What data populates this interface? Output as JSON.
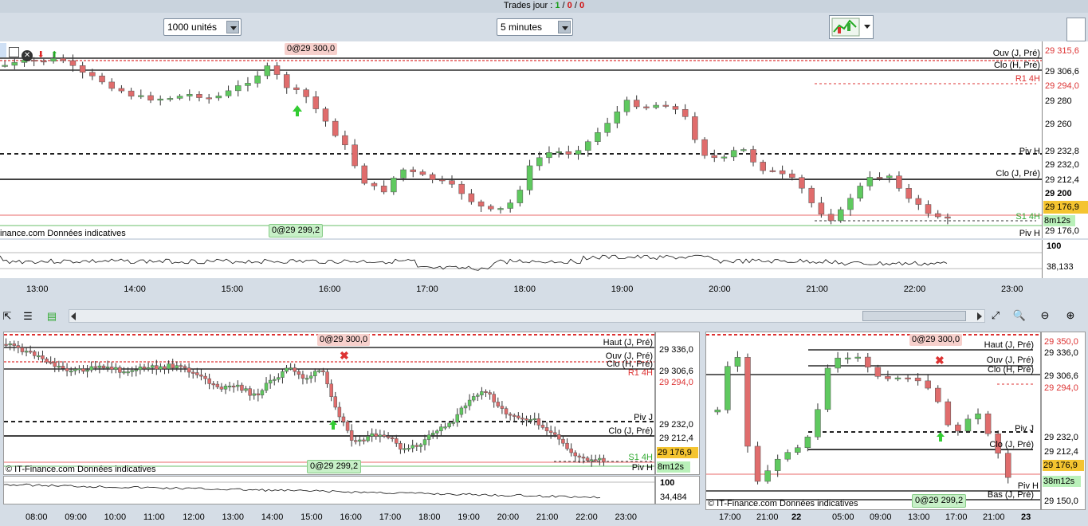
{
  "top": {
    "label": "Trades jour :",
    "v1": "1",
    "sep1": "/",
    "v2": "0",
    "sep2": "/",
    "v3": "0"
  },
  "controls": {
    "quantity": "1000 unités",
    "period": "5 minutes"
  },
  "main": {
    "pos_top": "0@29 300,0",
    "pos_bottom": "0@29 299,2",
    "credit": "inance.com  Données indicatives",
    "lines": {
      "ouv": "Ouv (J, Pré)",
      "clo_h": "Clo (H, Pré)",
      "r1": "R1 4H",
      "piv": "Piv H",
      "clo_j": "Clo (J, Pré)",
      "s1": "S1 4H",
      "piv_h": "Piv H"
    },
    "prices": [
      "29 315,6",
      "29 306,6",
      "29 294,0",
      "29 280",
      "29 260",
      "29 232,8",
      "29 232,0",
      "29 212,4",
      "29 200",
      "29 176,9",
      "8m12s",
      "29 176,0"
    ],
    "osc": {
      "top": "100",
      "val": "38,133"
    },
    "times": [
      "13:00",
      "14:00",
      "15:00",
      "16:00",
      "17:00",
      "18:00",
      "19:00",
      "20:00",
      "21:00",
      "22:00",
      "23:00"
    ]
  },
  "bl": {
    "pos_top": "0@29 300,0",
    "pos_bottom": "0@29 299,2",
    "credit": "© IT-Finance.com  Données indicatives",
    "lines": {
      "haut": "Haut (J, Pré)",
      "ouv": "Ouv (J, Pré)",
      "clo_h": "Clo (H, Pré)",
      "r1": "R1 4H",
      "pivj": "Piv J",
      "clo_j": "Clo (J, Pré)",
      "s1": "S1 4H",
      "piv_h": "Piv H"
    },
    "prices": [
      "29 336,0",
      "29 306,6",
      "29 294,0",
      "29 232,0",
      "29 212,4",
      "29 176,9",
      "8m12s"
    ],
    "osc": {
      "top": "100",
      "val": "34,484"
    },
    "times": [
      "08:00",
      "09:00",
      "10:00",
      "11:00",
      "12:00",
      "13:00",
      "14:00",
      "15:00",
      "16:00",
      "17:00",
      "18:00",
      "19:00",
      "20:00",
      "21:00",
      "22:00",
      "23:00"
    ]
  },
  "br": {
    "pos_top": "0@29 300,0",
    "pos_bottom": "0@29 299,2",
    "credit": "© IT-Finance.com  Données indicatives",
    "lines": {
      "haut": "Haut (J, Pré)",
      "ouv": "Ouv (J, Pré)",
      "clo_h": "Clo (H, Pré)",
      "pivj": "Piv J",
      "clo_j": "Clo (J, Pré)",
      "piv_h": "Piv H",
      "bas": "Bas (J, Pré)"
    },
    "prices": [
      "29 350,0",
      "29 336,0",
      "29 306,6",
      "29 294,0",
      "29 232,0",
      "29 212,4",
      "29 176,9",
      "38m12s",
      "29 150,0"
    ],
    "times": [
      "17:00",
      "21:00",
      "22",
      "05:00",
      "09:00",
      "13:00",
      "17:00",
      "21:00",
      "23"
    ]
  },
  "colors": {
    "bull": "#5fc95f",
    "bear": "#e06c6c",
    "current": "#f4c430",
    "timer": "#b9f0b9"
  }
}
